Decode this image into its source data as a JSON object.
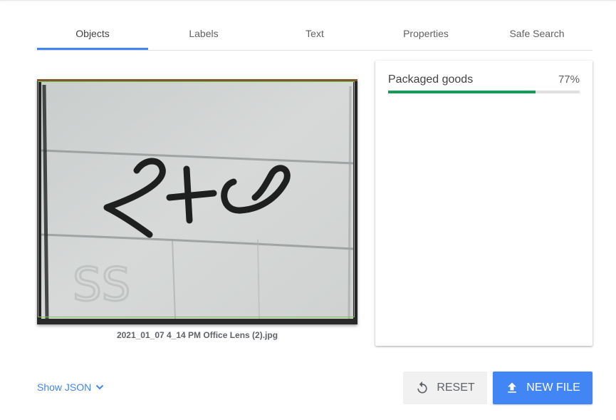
{
  "tabs": [
    {
      "label": "Objects",
      "active": true
    },
    {
      "label": "Labels",
      "active": false
    },
    {
      "label": "Text",
      "active": false
    },
    {
      "label": "Properties",
      "active": false
    },
    {
      "label": "Safe Search",
      "active": false
    }
  ],
  "image": {
    "filename": "2021_01_07 4_14 PM Office Lens (2).jpg",
    "handwriting": "2+6",
    "bbox_color": "#7cc94a"
  },
  "results": [
    {
      "label": "Packaged goods",
      "percent_text": "77%",
      "confidence": 0.77,
      "bar_color": "#0f9d58"
    }
  ],
  "footer": {
    "show_json_label": "Show JSON",
    "reset_label": "RESET",
    "new_file_label": "NEW FILE"
  },
  "colors": {
    "accent": "#4285f4",
    "success": "#0f9d58"
  },
  "icons": {
    "show_json": "chevron-down-icon",
    "reset": "reset-icon",
    "new_file": "upload-icon"
  }
}
